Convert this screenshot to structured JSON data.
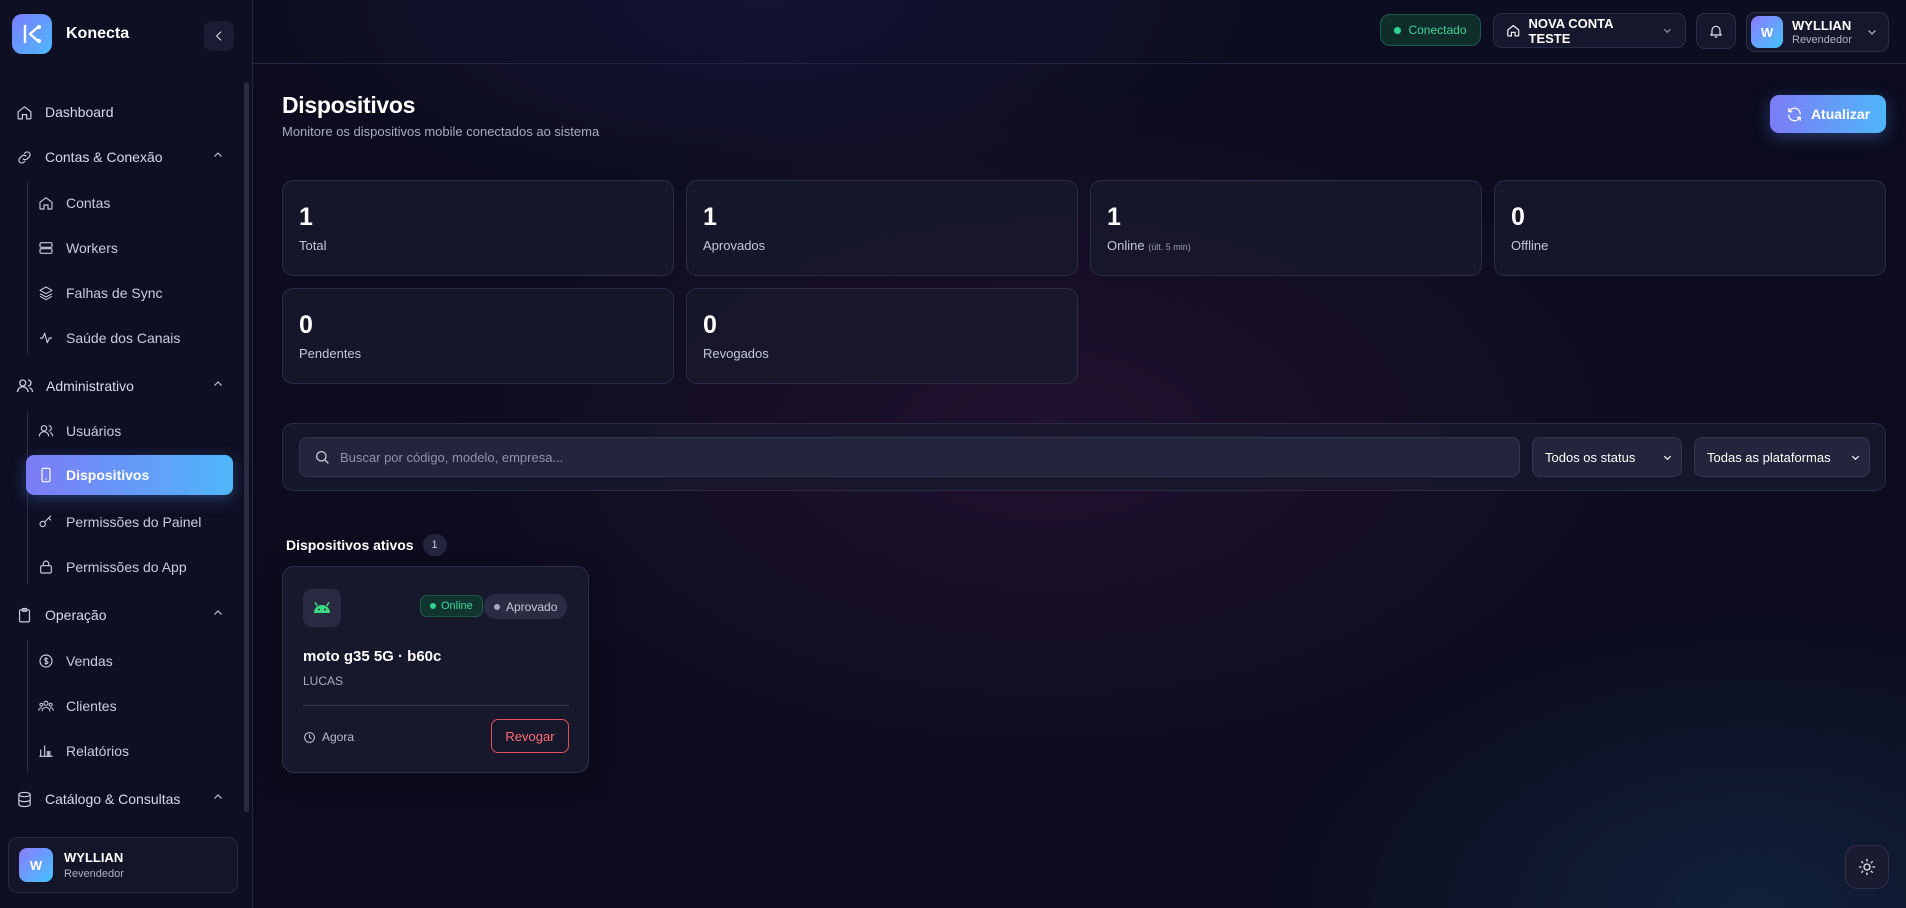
{
  "app": {
    "name": "Konecta"
  },
  "sidebar": {
    "items": [
      {
        "label": "Dashboard"
      },
      {
        "label": "Contas & Conexão"
      },
      {
        "label": "Contas"
      },
      {
        "label": "Workers"
      },
      {
        "label": "Falhas de Sync"
      },
      {
        "label": "Saúde dos Canais"
      },
      {
        "label": "Administrativo"
      },
      {
        "label": "Usuários"
      },
      {
        "label": "Dispositivos"
      },
      {
        "label": "Permissões do Painel"
      },
      {
        "label": "Permissões do App"
      },
      {
        "label": "Operação"
      },
      {
        "label": "Vendas"
      },
      {
        "label": "Clientes"
      },
      {
        "label": "Relatórios"
      },
      {
        "label": "Catálogo & Consultas"
      }
    ],
    "user": {
      "initial": "W",
      "name": "WYLLIAN",
      "role": "Revendedor"
    }
  },
  "header": {
    "status": "Conectado",
    "account": "NOVA CONTA TESTE",
    "user": {
      "initial": "W",
      "name": "WYLLIAN",
      "role": "Revendedor"
    }
  },
  "page": {
    "title": "Dispositivos",
    "subtitle": "Monitore os dispositivos mobile conectados ao sistema",
    "refresh_label": "Atualizar"
  },
  "stats": [
    {
      "value": "1",
      "label": "Total"
    },
    {
      "value": "1",
      "label": "Aprovados"
    },
    {
      "value": "1",
      "label": "Online",
      "note": "(últ. 5 min)"
    },
    {
      "value": "0",
      "label": "Offline"
    },
    {
      "value": "0",
      "label": "Pendentes"
    },
    {
      "value": "0",
      "label": "Revogados"
    }
  ],
  "filters": {
    "search_placeholder": "Buscar por código, modelo, empresa...",
    "status_selected": "Todos os status",
    "platform_selected": "Todas as plataformas"
  },
  "devices": {
    "title": "Dispositivos ativos",
    "count": "1",
    "items": [
      {
        "name": "moto g35 5G · b60c",
        "company": "LUCAS",
        "status": "Online",
        "approval": "Aprovado",
        "last_seen": "Agora",
        "action": "Revogar"
      }
    ]
  },
  "colors": {
    "accent_start": "#7c7cf6",
    "accent_end": "#4fb6fb",
    "online": "#2fd392",
    "danger": "#e0515c"
  }
}
